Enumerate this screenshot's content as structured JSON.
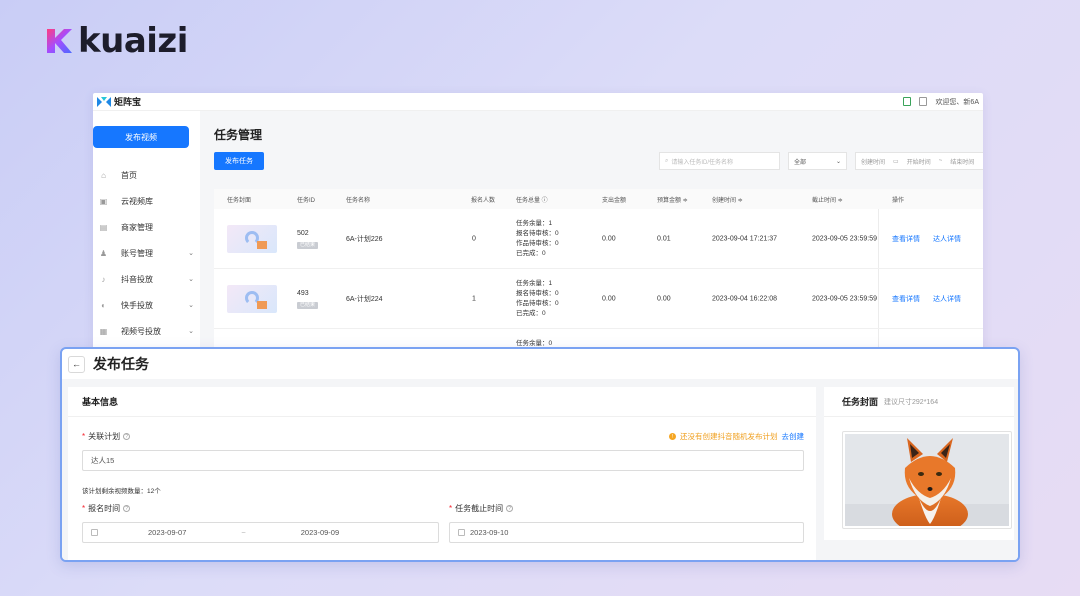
{
  "brand": {
    "name": "kuaizi"
  },
  "app": {
    "logo_text": "矩阵宝",
    "welcome": "欢迎您、新6A",
    "sidebar": {
      "publish_label": "发布视频",
      "items": [
        {
          "label": "首页",
          "icon": "home-icon",
          "glyph": "⌂",
          "has_chevron": false
        },
        {
          "label": "云视频库",
          "icon": "video-library-icon",
          "glyph": "▣",
          "has_chevron": false
        },
        {
          "label": "商家管理",
          "icon": "store-icon",
          "glyph": "▤",
          "has_chevron": false
        },
        {
          "label": "账号管理",
          "icon": "user-icon",
          "glyph": "♟",
          "has_chevron": true
        },
        {
          "label": "抖音投放",
          "icon": "douyin-icon",
          "glyph": "♪",
          "has_chevron": true
        },
        {
          "label": "快手投放",
          "icon": "kuaishou-icon",
          "glyph": "◐",
          "has_chevron": true
        },
        {
          "label": "视频号投放",
          "icon": "channels-icon",
          "glyph": "▦",
          "has_chevron": true
        }
      ]
    },
    "page_title": "任务管理",
    "create_task_label": "发布任务",
    "search_placeholder": "请输入任务ID/任务名称",
    "status_select": "全部",
    "date_type": "创建时间",
    "start_placeholder": "开始时间",
    "end_placeholder": "结束时间",
    "date_separator": "~",
    "table": {
      "headers": {
        "cover": "任务封面",
        "id": "任务ID",
        "name": "任务名称",
        "signup": "报名人数",
        "total": "任务总量 ⓘ",
        "spent": "支出金额",
        "budget": "预算金额 ≑",
        "created": "创建时间 ≑",
        "deadline": "截止时间 ≑",
        "ops": "操作"
      },
      "rows": [
        {
          "id": "502",
          "status": "已结束",
          "name": "6A-计划226",
          "signup": "0",
          "stats": [
            "任务余量：1",
            "报名待审核：0",
            "作品待审核：0",
            "已完成：0"
          ],
          "spent": "0.00",
          "budget": "0.01",
          "created": "2023-09-04 17:21:37",
          "deadline": "2023-09-05 23:59:59",
          "view": "查看详情",
          "talent": "达人详情"
        },
        {
          "id": "493",
          "status": "已结束",
          "name": "6A-计划224",
          "signup": "1",
          "stats": [
            "任务余量：1",
            "报名待审核：0",
            "作品待审核：0",
            "已完成：0"
          ],
          "spent": "0.00",
          "budget": "0.00",
          "created": "2023-09-04 16:22:08",
          "deadline": "2023-09-05 23:59:59",
          "view": "查看详情",
          "talent": "达人详情"
        }
      ],
      "partial_row_stat": "任务余量：0"
    }
  },
  "modal": {
    "title": "发布任务",
    "section_title": "基本信息",
    "plan_label": "关联计划",
    "plan_value": "达人15",
    "tip_text": "还没有创建抖音随机发布计划",
    "tip_link": "去创建",
    "remaining_hint": "该计划剩余视频数量：12个",
    "signup_label": "报名时间",
    "signup_start": "2023-09-07",
    "signup_sep": "~",
    "signup_end": "2023-09-09",
    "deadline_label": "任务截止时间",
    "deadline_value": "2023-09-10",
    "cover_title": "任务封面",
    "cover_hint": "建议尺寸292*164"
  }
}
